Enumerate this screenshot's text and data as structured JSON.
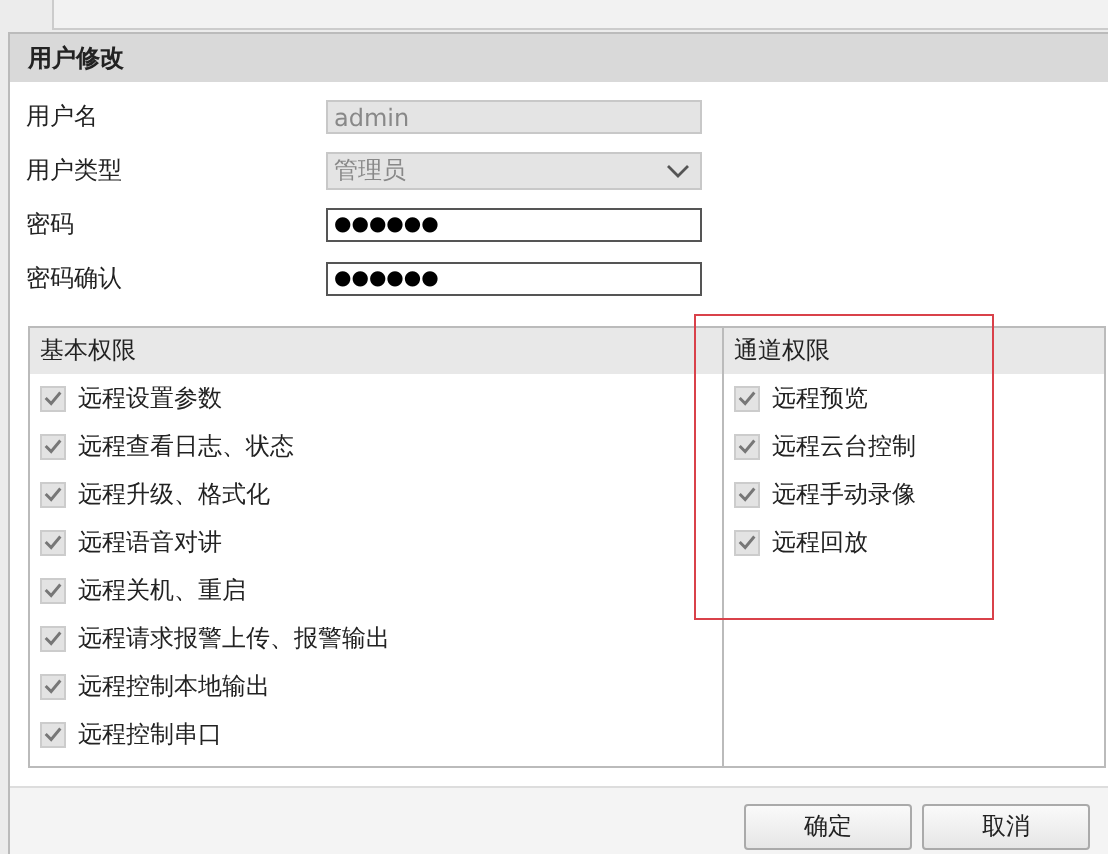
{
  "dialog": {
    "title": "用户修改"
  },
  "fields": [
    {
      "label": "用户名",
      "kind": "text",
      "value": "admin",
      "disabled": true
    },
    {
      "label": "用户类型",
      "kind": "select",
      "value": "管理员",
      "disabled": true
    },
    {
      "label": "密码",
      "kind": "password",
      "value": "●●●●●●",
      "disabled": false
    },
    {
      "label": "密码确认",
      "kind": "password",
      "value": "●●●●●●",
      "disabled": false
    }
  ],
  "basic_permissions": {
    "title": "基本权限",
    "items": [
      {
        "label": "远程设置参数",
        "checked": true
      },
      {
        "label": "远程查看日志、状态",
        "checked": true
      },
      {
        "label": "远程升级、格式化",
        "checked": true
      },
      {
        "label": "远程语音对讲",
        "checked": true
      },
      {
        "label": "远程关机、重启",
        "checked": true
      },
      {
        "label": "远程请求报警上传、报警输出",
        "checked": true
      },
      {
        "label": "远程控制本地输出",
        "checked": true
      },
      {
        "label": "远程控制串口",
        "checked": true
      }
    ]
  },
  "channel_permissions": {
    "title": "通道权限",
    "highlighted": true,
    "items": [
      {
        "label": "远程预览",
        "checked": true
      },
      {
        "label": "远程云台控制",
        "checked": true
      },
      {
        "label": "远程手动录像",
        "checked": true
      },
      {
        "label": "远程回放",
        "checked": true
      }
    ]
  },
  "buttons": [
    "确定",
    "取消"
  ]
}
